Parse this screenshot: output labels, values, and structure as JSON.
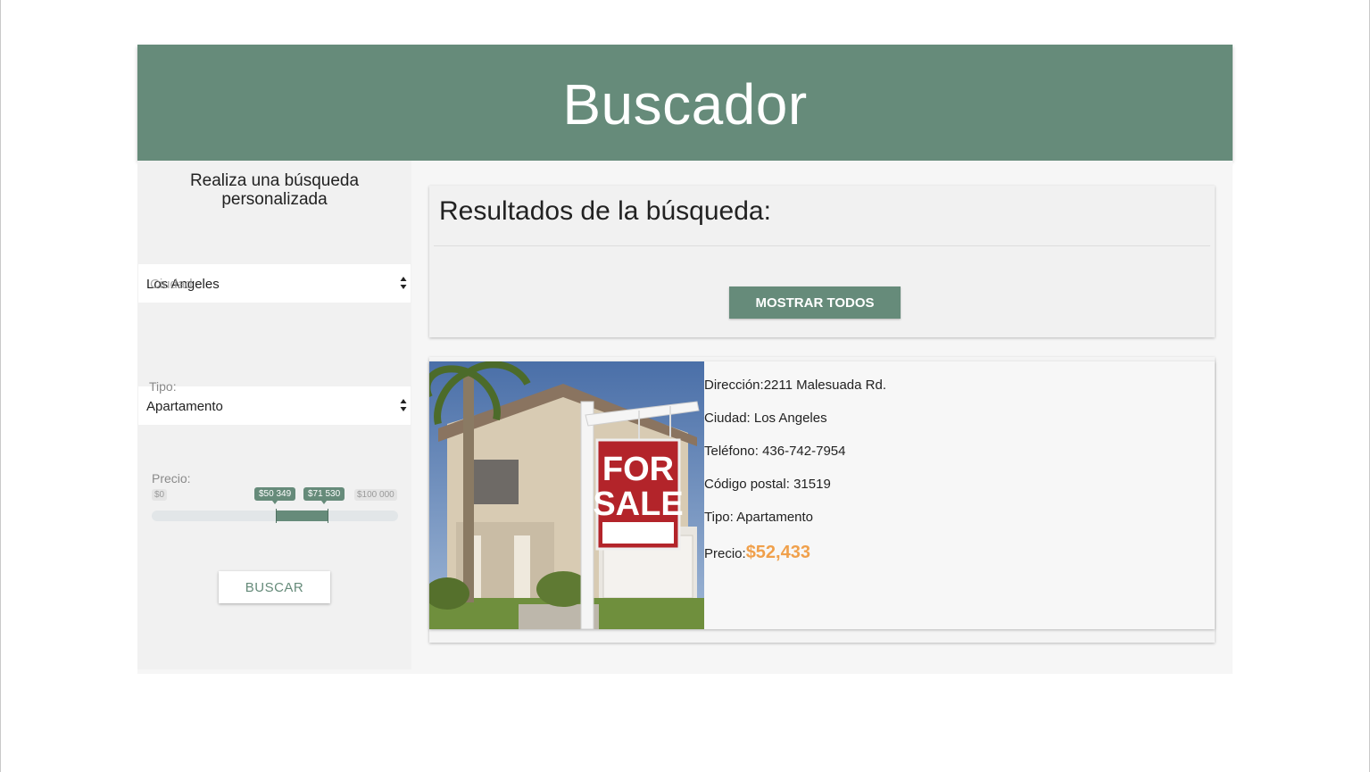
{
  "header": {
    "title": "Buscador"
  },
  "sidebar": {
    "title": "Realiza una búsqueda personalizada",
    "ciudad": {
      "placeholder": "Ciudad",
      "value": "Los Angeles"
    },
    "tipo": {
      "label": "Tipo:",
      "value": "Apartamento"
    },
    "precio": {
      "label": "Precio:",
      "min_label": "$0",
      "max_label": "$100 000",
      "from_label": "$50 349",
      "to_label": "$71 530",
      "min": 0,
      "max": 100000,
      "from": 50349,
      "to": 71530
    },
    "search_button": "BUSCAR"
  },
  "results": {
    "title": "Resultados de la búsqueda:",
    "show_all_button": "MOSTRAR TODOS",
    "items": [
      {
        "image_alt": "FOR SALE",
        "sign_line1": "FOR",
        "sign_line2": "SALE",
        "direccion_label": "Dirección:",
        "direccion": "2211 Malesuada Rd.",
        "ciudad_label": "Ciudad:",
        "ciudad": "Los Angeles",
        "telefono_label": "Teléfono:",
        "telefono": "436-742-7954",
        "codigo_label": "Código postal:",
        "codigo": "31519",
        "tipo_label": "Tipo:",
        "tipo": "Apartamento",
        "precio_label": "Precio:",
        "precio": "$52,433"
      }
    ]
  },
  "colors": {
    "accent": "#668b7a",
    "price": "#f0a04b",
    "panel": "#f1f1f1"
  }
}
